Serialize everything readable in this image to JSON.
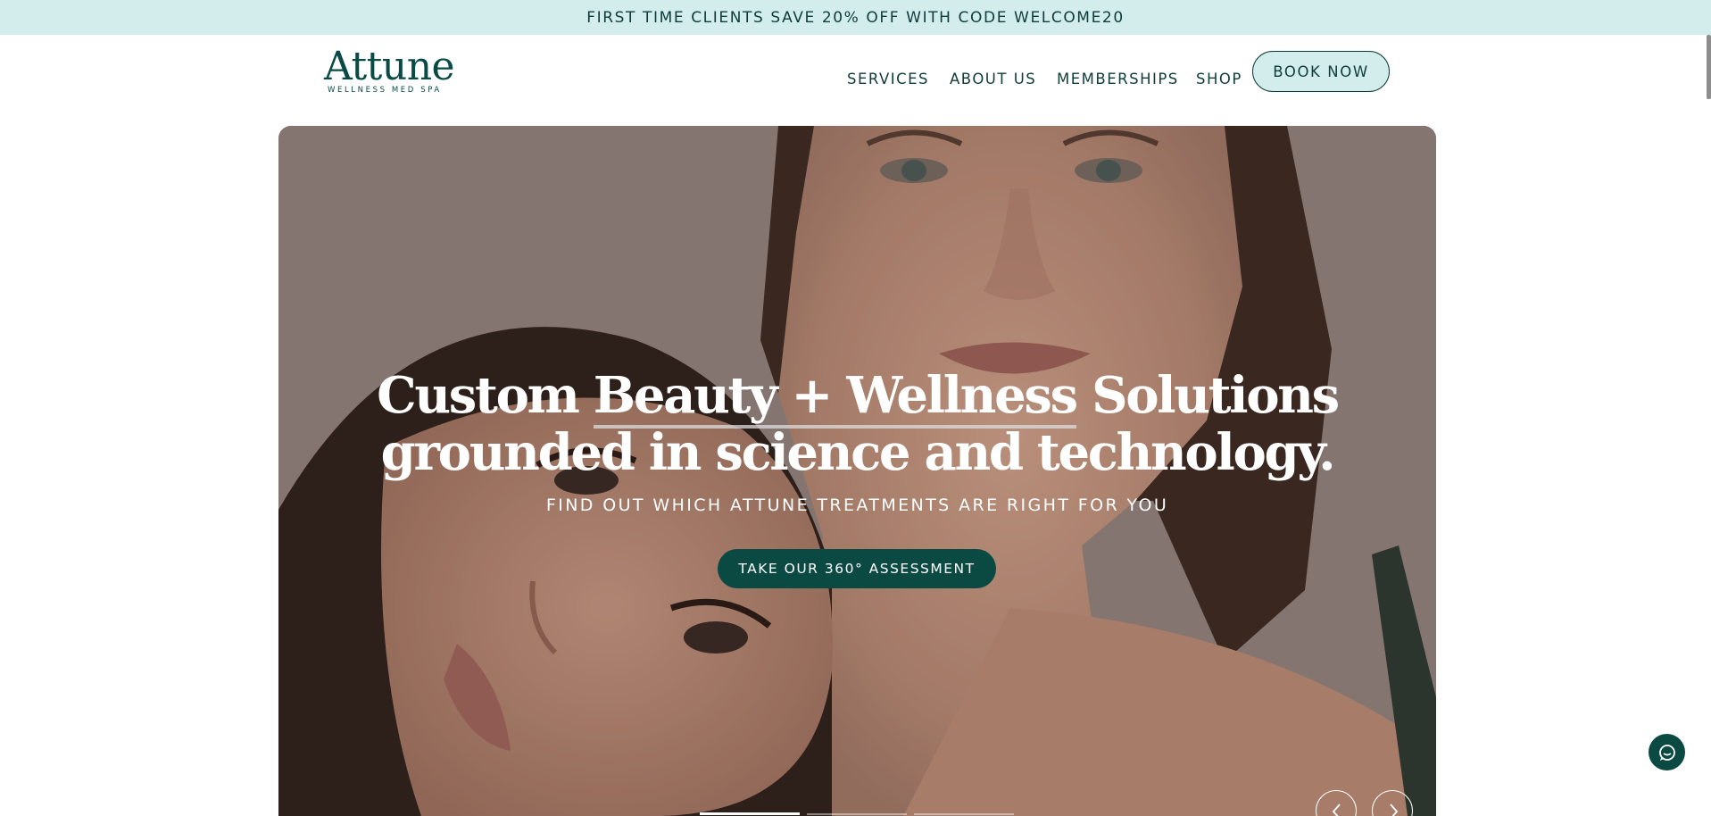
{
  "announcement": {
    "text": "FIRST TIME CLIENTS SAVE 20% OFF WITH CODE WELCOME20"
  },
  "logo": {
    "name": "Attune",
    "tagline": "WELLNESS MED SPA"
  },
  "nav": {
    "items": [
      {
        "label": "SERVICES"
      },
      {
        "label": "ABOUT US"
      },
      {
        "label": "MEMBERSHIPS"
      },
      {
        "label": "SHOP"
      }
    ],
    "book_label": "BOOK NOW"
  },
  "hero": {
    "headline_part1": "Custom ",
    "headline_underlined": "Beauty + Wellness",
    "headline_part2": " Solutions",
    "headline_line2": "grounded in science and technology.",
    "subheading": "FIND OUT WHICH ATTUNE TREATMENTS ARE RIGHT FOR YOU",
    "cta_label": "TAKE OUR 360° ASSESSMENT",
    "slides": {
      "count": 3,
      "active": 1
    }
  },
  "icons": {
    "prev": "chevron-left-icon",
    "next": "chevron-right-icon",
    "chat": "chat-icon"
  },
  "colors": {
    "brand": "#0b4a42",
    "announcement_bg": "#d3ecec",
    "text": "#0e3d3a"
  }
}
